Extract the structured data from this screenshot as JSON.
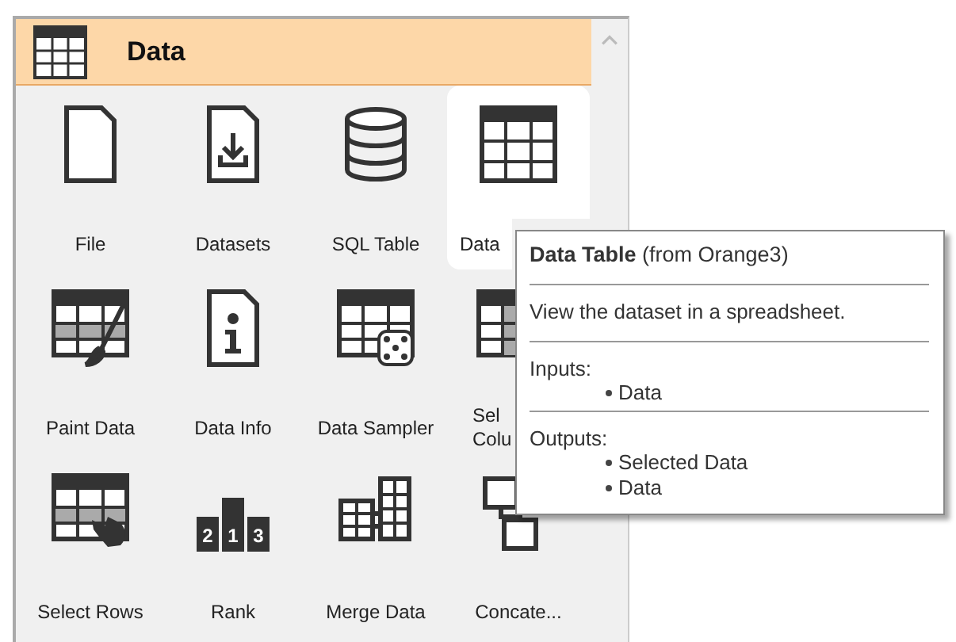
{
  "category": {
    "title": "Data"
  },
  "widgets": [
    {
      "kind": "file",
      "label": "File",
      "hovered": false
    },
    {
      "kind": "datasets",
      "label": "Datasets",
      "hovered": false
    },
    {
      "kind": "sql-table",
      "label": "SQL Table",
      "hovered": false
    },
    {
      "kind": "data-table",
      "label": "Data",
      "hovered": true
    },
    {
      "kind": "paint-data",
      "label": "Paint Data",
      "hovered": false
    },
    {
      "kind": "data-info",
      "label": "Data Info",
      "hovered": false
    },
    {
      "kind": "data-sampler",
      "label": "Data Sampler",
      "hovered": false
    },
    {
      "kind": "select-columns",
      "label": "Sel Colu",
      "hovered": false
    },
    {
      "kind": "select-rows",
      "label": "Select Rows",
      "hovered": false
    },
    {
      "kind": "rank",
      "label": "Rank",
      "digits": [
        "2",
        "1",
        "3"
      ],
      "hovered": false
    },
    {
      "kind": "merge-data",
      "label": "Merge Data",
      "hovered": false
    },
    {
      "kind": "concatenate",
      "label": "Concate...",
      "hovered": false
    }
  ],
  "tooltip": {
    "title": "**Data Table** (from Orange3)",
    "description": "View the dataset in a spreadsheet.",
    "sections": [
      {
        "heading": "Inputs:",
        "items": [
          "Data"
        ]
      },
      {
        "heading": "Outputs:",
        "items": [
          "Selected Data",
          "Data"
        ]
      }
    ]
  }
}
